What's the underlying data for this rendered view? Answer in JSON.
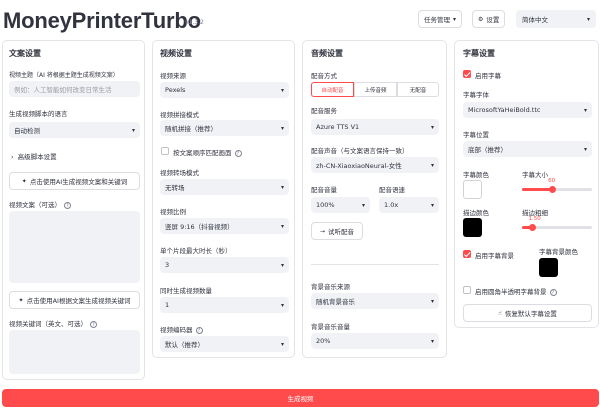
{
  "header": {
    "title": "MoneyPrinterTurbo",
    "version": "v1.3.2",
    "task_mgmt_label": "任务管理",
    "settings_label": "设置",
    "language_value": "简体中文"
  },
  "script": {
    "title": "文案设置",
    "subject_label": "视频主题（AI 将根据主题生成视频文案）",
    "subject_placeholder": "例如：人工智能如何改变日常生活",
    "language_label": "生成视频脚本的语言",
    "language_value": "自动检测",
    "advanced_label": "高级脚本设置",
    "gen_script_button": "点击使用AI生成视频文案和关键词",
    "script_label": "视频文案（可选）",
    "gen_keywords_button": "点击使用AI根据文案生成视频关键词",
    "keywords_label": "视频关键词（英文、可选）"
  },
  "video": {
    "title": "视频设置",
    "source_label": "视频来源",
    "source_value": "Pexels",
    "concat_label": "视频拼接模式",
    "concat_value": "随机拼接（推荐）",
    "match_label": "按文案顺序匹配画面",
    "transition_label": "视频转场模式",
    "transition_value": "无转场",
    "ratio_label": "视频比例",
    "ratio_value": "竖屏 9:16（抖音视频）",
    "clip_label": "单个片段最大时长（秒）",
    "clip_value": "3",
    "count_label": "同时生成视频数量",
    "count_value": "1",
    "codec_label": "视频编码器",
    "codec_value": "默认（推荐）"
  },
  "audio": {
    "title": "音频设置",
    "mode_label": "配音方式",
    "modes": [
      "自动配音",
      "上传音频",
      "无配音"
    ],
    "service_label": "配音服务",
    "service_value": "Azure TTS V1",
    "voice_label": "配音声音（与文案语言保持一致）",
    "voice_value": "zh-CN-XiaoxiaoNeural-女性",
    "volume_label": "配音音量",
    "volume_value": "100%",
    "rate_label": "配音语速",
    "rate_value": "1.0x",
    "try_button": "试听配音",
    "bgm_label": "背景音乐来源",
    "bgm_value": "随机背景音乐",
    "bgm_volume_label": "背景音乐音量",
    "bgm_volume_value": "20%"
  },
  "subtitle": {
    "title": "字幕设置",
    "enable_label": "启用字幕",
    "font_label": "字幕字体",
    "font_value": "MicrosoftYaHeiBold.ttc",
    "position_label": "字幕位置",
    "position_value": "底部（推荐）",
    "color_label": "字幕颜色",
    "size_label": "字幕大小",
    "size_value": "60",
    "stroke_color_label": "描边颜色",
    "stroke_width_label": "描边粗细",
    "stroke_width_value": "1.50",
    "bg_enable_label": "启用字幕背景",
    "bg_color_label": "字幕背景颜色",
    "rounded_label": "启用圆角半透明字幕背景",
    "reset_button": "恢复默认字幕设置",
    "font_color": "#ffffff",
    "stroke_color": "#000000",
    "bg_color": "#000000",
    "size_fraction": 0.43,
    "stroke_fraction": 0.15
  },
  "footer": {
    "generate_button": "生成视频"
  }
}
